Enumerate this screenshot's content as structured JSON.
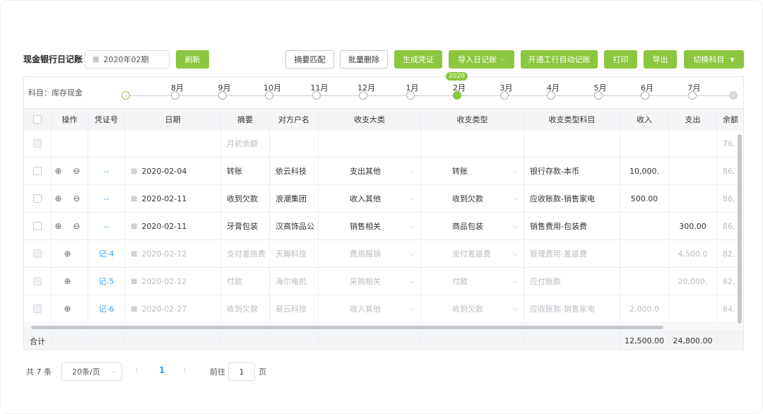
{
  "toolbar": {
    "title": "现金银行日记账",
    "period": "2020年02期",
    "refresh": "刷新",
    "match": "摘要匹配",
    "batch_delete": "批量删除",
    "gen_voucher": "生成凭证",
    "import": "导入日记账",
    "icbc": "开通工行自动记账",
    "print": "打印",
    "export": "导出",
    "switch": "切换科目"
  },
  "timeline": {
    "label": "科目：库存现金",
    "year": "2020",
    "months": [
      "8月",
      "9月",
      "10月",
      "11月",
      "12月",
      "1月",
      "2月",
      "3月",
      "4月",
      "5月",
      "6月",
      "7月"
    ],
    "active_index": 6
  },
  "columns": [
    "操作",
    "凭证号",
    "日期",
    "摘要",
    "对方户名",
    "收支大类",
    "收支类型",
    "收支类型科目",
    "收入",
    "支出",
    "余额"
  ],
  "rows": [
    {
      "op": "",
      "voucher": "",
      "date": "",
      "summary": "月初余额",
      "party": "",
      "major": "",
      "type": "",
      "subject": "",
      "income": "",
      "expense": "",
      "balance": "76,",
      "muted": true
    },
    {
      "op": "⊕ ⊖",
      "voucher": "--",
      "date": "2020-02-04",
      "summary": "转账",
      "party": "依云科技",
      "major": "支出其他",
      "type": "转账",
      "subject": "银行存款-本币",
      "income": "10,000.",
      "expense": "",
      "balance": "86,",
      "muted": false
    },
    {
      "op": "⊕ ⊖",
      "voucher": "--",
      "date": "2020-02-11",
      "summary": "收到欠款",
      "party": "浪潮集团",
      "major": "收入其他",
      "type": "收到欠款",
      "subject": "应收账款-销售家电",
      "income": "500.00",
      "expense": "",
      "balance": "86,",
      "muted": false
    },
    {
      "op": "⊕ ⊖",
      "voucher": "--",
      "date": "2020-02-11",
      "summary": "牙膏包装",
      "party": "汉高饰品公",
      "major": "销售相关",
      "type": "商品包装",
      "subject": "销售费用-包装费",
      "income": "",
      "expense": "300.00",
      "balance": "86,",
      "muted": false
    },
    {
      "op": "⊕",
      "voucher": "记-4",
      "date": "2020-02-12",
      "summary": "支付差旅费",
      "party": "天脚科技",
      "major": "费用报销",
      "type": "支付差旅费",
      "subject": "管理费用-差旅费",
      "income": "",
      "expense": "4,500.0",
      "balance": "82,",
      "muted": true
    },
    {
      "op": "⊕",
      "voucher": "记-5",
      "date": "2020-02-12",
      "summary": "付款",
      "party": "海尔电机",
      "major": "采购相关",
      "type": "付款",
      "subject": "应付账款",
      "income": "",
      "expense": "20,000.",
      "balance": "62,",
      "muted": true
    },
    {
      "op": "⊕",
      "voucher": "记-6",
      "date": "2020-02-27",
      "summary": "收到欠款",
      "party": "易云科技",
      "major": "收入其他",
      "type": "收到欠款",
      "subject": "应收账款-销售家电",
      "income": "2,000.0",
      "expense": "",
      "balance": "64,",
      "muted": true
    }
  ],
  "totals": {
    "label": "合计",
    "income": "12,500.00",
    "expense": "24,800.00"
  },
  "pagination": {
    "total": "共 7 条",
    "size": "20条/页",
    "current": "1",
    "goto": "前往",
    "goto_value": "1",
    "page": "页"
  }
}
